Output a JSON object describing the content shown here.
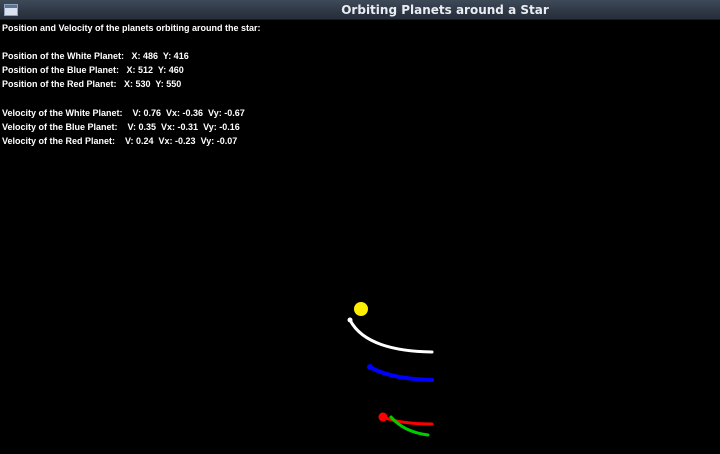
{
  "window": {
    "title": "Orbiting Planets around a Star"
  },
  "info": {
    "heading": "Position and Velocity of the planets orbiting around the star:",
    "positions": [
      "Position of the White Planet:   X: 486  Y: 416",
      "Position of the Blue Planet:   X: 512  Y: 460",
      "Position of the Red Planet:   X: 530  Y: 550"
    ],
    "velocities": [
      "Velocity of the White Planet:    V: 0.76  Vx: -0.36  Vy: -0.67",
      "Velocity of the Blue Planet:    V: 0.35  Vx: -0.31  Vy: -0.16",
      "Velocity of the Red Planet:    V: 0.24  Vx: -0.23  Vy: -0.07"
    ]
  },
  "colors": {
    "star": "#ffee00",
    "white_planet": "#ffffff",
    "blue_planet": "#0000ff",
    "red_planet": "#ff0000",
    "green_trail": "#00cc00"
  },
  "icons": {
    "app": "window-app-icon"
  }
}
